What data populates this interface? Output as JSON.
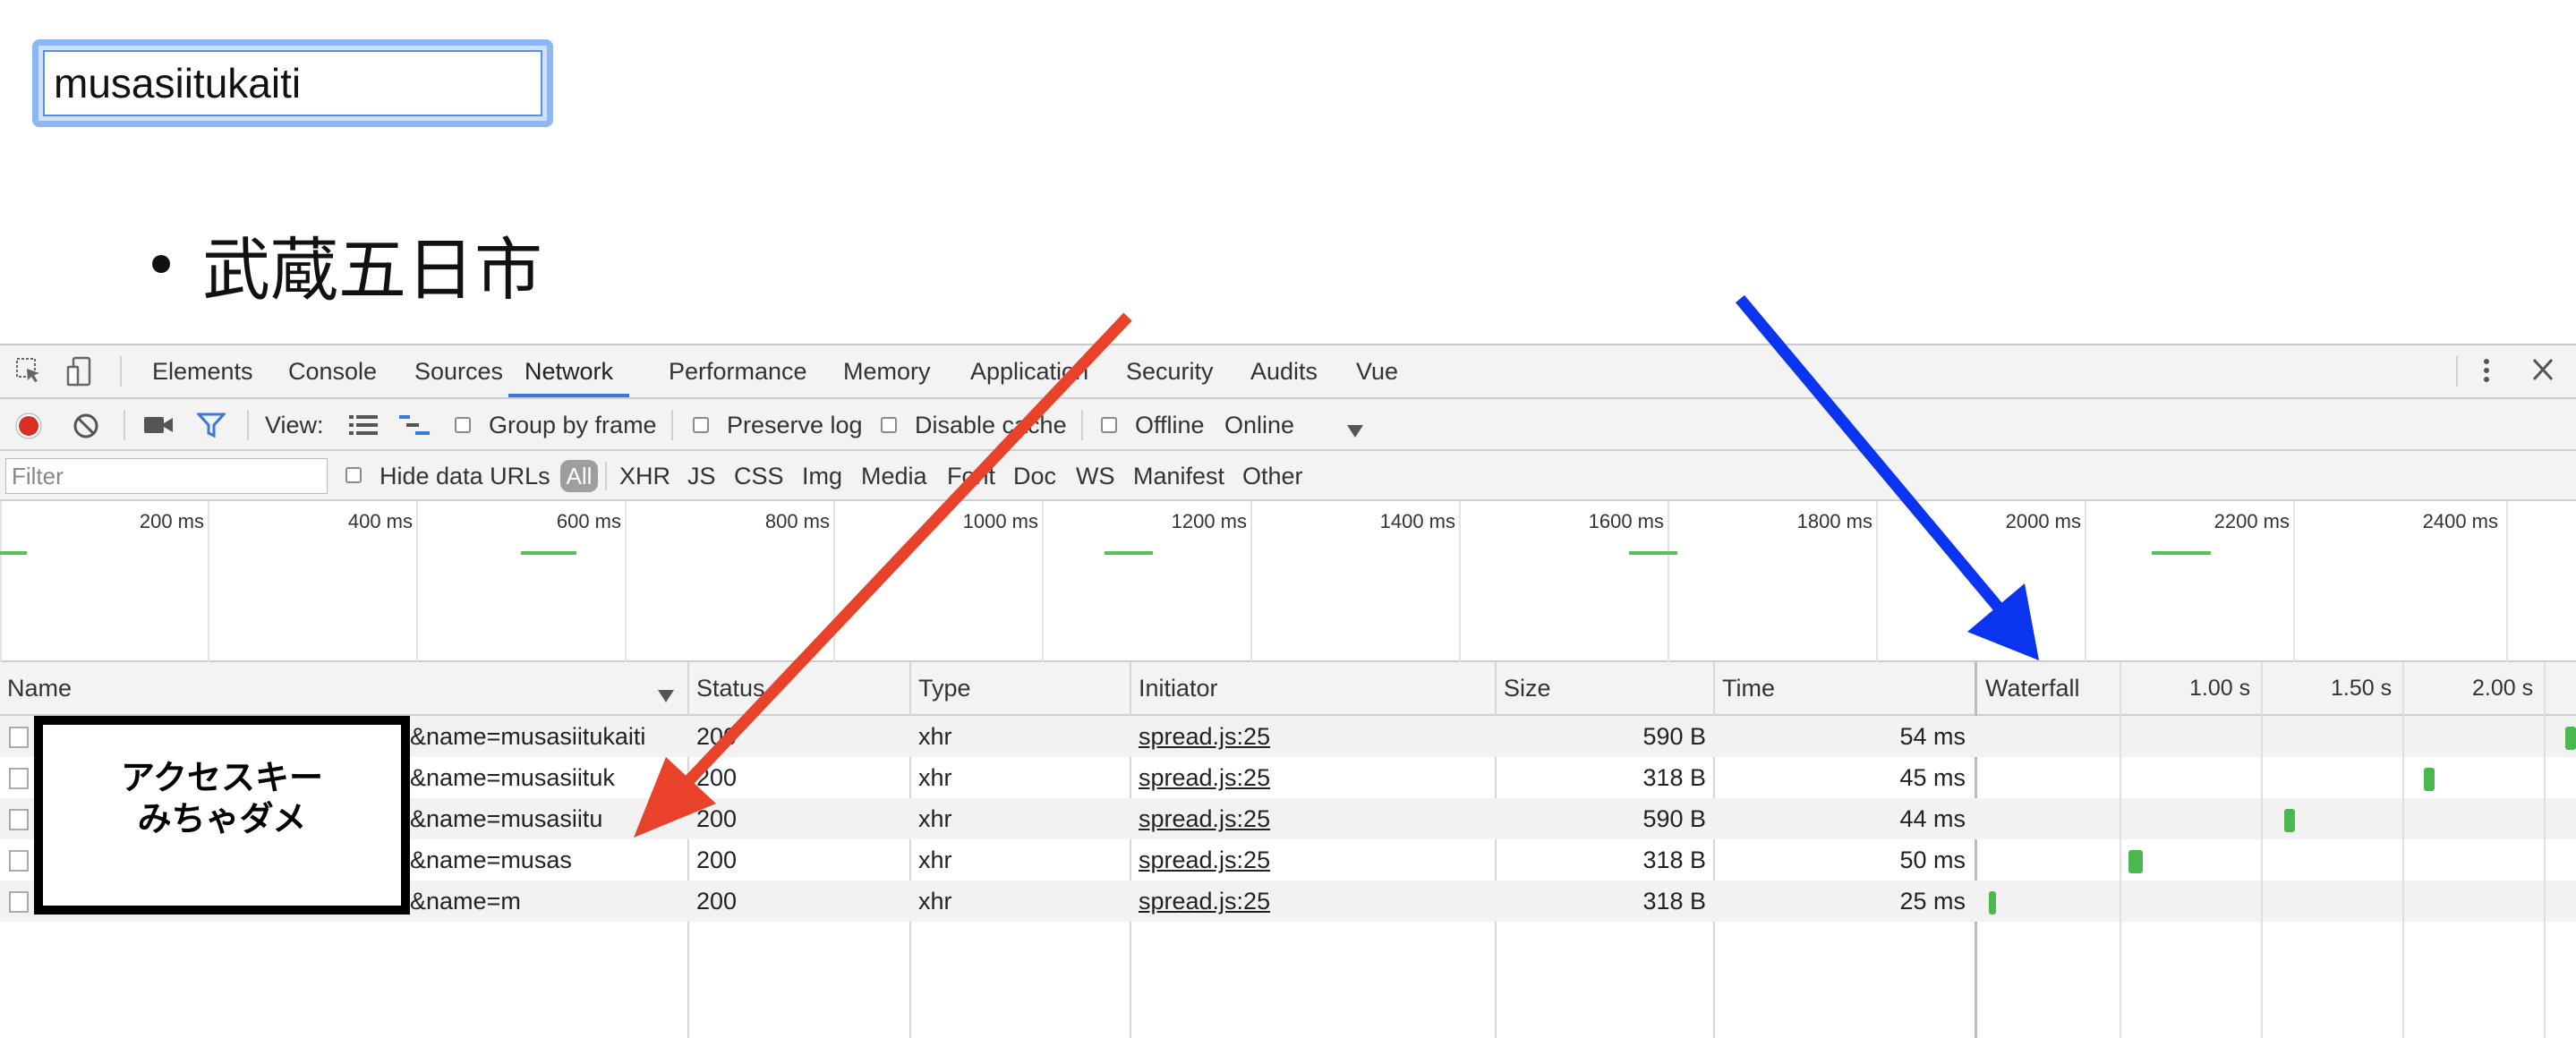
{
  "page": {
    "search_value": "musasiitukaiti",
    "results": [
      "武蔵五日市"
    ]
  },
  "devtools": {
    "tabs": [
      "Elements",
      "Console",
      "Sources",
      "Network",
      "Performance",
      "Memory",
      "Application",
      "Security",
      "Audits",
      "Vue"
    ],
    "active_tab": "Network",
    "toolbar": {
      "view_label": "View:",
      "group_by_frame": "Group by frame",
      "preserve_log": "Preserve log",
      "disable_cache": "Disable cache",
      "offline": "Offline",
      "throttle": "Online"
    },
    "filterbar": {
      "filter_placeholder": "Filter",
      "hide_data_urls": "Hide data URLs",
      "types": [
        "All",
        "XHR",
        "JS",
        "CSS",
        "Img",
        "Media",
        "Font",
        "Doc",
        "WS",
        "Manifest",
        "Other"
      ]
    },
    "overview_ticks": [
      "200 ms",
      "400 ms",
      "600 ms",
      "800 ms",
      "1000 ms",
      "1200 ms",
      "1400 ms",
      "1600 ms",
      "1800 ms",
      "2000 ms",
      "2200 ms",
      "2400 ms"
    ],
    "columns": {
      "name": "Name",
      "status": "Status",
      "type": "Type",
      "initiator": "Initiator",
      "size": "Size",
      "time": "Time",
      "waterfall": "Waterfall",
      "waterfall_ticks": [
        "1.00 s",
        "1.50 s",
        "2.00 s"
      ]
    },
    "requests": [
      {
        "name": "&name=musasiitukaiti",
        "status": "200",
        "type": "xhr",
        "initiator": "spread.js:25",
        "size": "590 B",
        "time": "54 ms"
      },
      {
        "name": "&name=musasiituk",
        "status": "200",
        "type": "xhr",
        "initiator": "spread.js:25",
        "size": "318 B",
        "time": "45 ms"
      },
      {
        "name": "&name=musasiitu",
        "status": "200",
        "type": "xhr",
        "initiator": "spread.js:25",
        "size": "590 B",
        "time": "44 ms"
      },
      {
        "name": "&name=musas",
        "status": "200",
        "type": "xhr",
        "initiator": "spread.js:25",
        "size": "318 B",
        "time": "50 ms"
      },
      {
        "name": "&name=m",
        "status": "200",
        "type": "xhr",
        "initiator": "spread.js:25",
        "size": "318 B",
        "time": "25 ms"
      }
    ]
  },
  "annotation": {
    "redaction_line1": "アクセスキー",
    "redaction_line2": "みちゃダメ"
  },
  "colors": {
    "active_tab": "#3879d9",
    "record": "#d93025",
    "timing_bar": "#49b84f",
    "red_arrow": "#e8432a",
    "blue_arrow": "#0a34f0"
  }
}
